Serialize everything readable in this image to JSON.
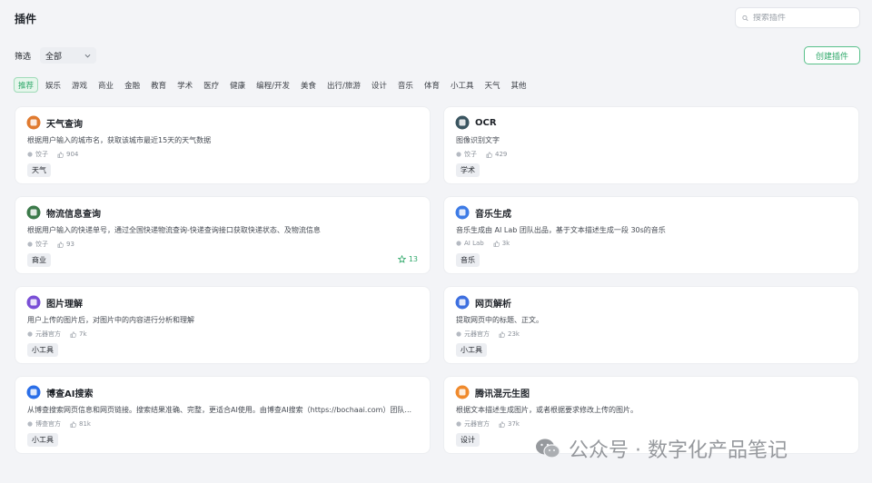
{
  "header": {
    "title": "插件",
    "search_placeholder": "搜索插件"
  },
  "filter": {
    "label": "筛选",
    "selected": "全部"
  },
  "create_button": "创建插件",
  "tags": [
    "推荐",
    "娱乐",
    "游戏",
    "商业",
    "金融",
    "教育",
    "学术",
    "医疗",
    "健康",
    "编程/开发",
    "美食",
    "出行/旅游",
    "设计",
    "音乐",
    "体育",
    "小工具",
    "天气",
    "其他"
  ],
  "cards": [
    {
      "title": "天气查询",
      "desc": "根据用户输入的城市名，获取该城市最近15天的天气数据",
      "author": "饺子",
      "likes": "904",
      "tag": "天气",
      "star": "",
      "icon": "weather-icon",
      "color": "#e07a2f"
    },
    {
      "title": "OCR",
      "desc": "图像识别文字",
      "author": "饺子",
      "likes": "429",
      "tag": "学术",
      "star": "",
      "icon": "ocr-icon",
      "color": "#3a5560"
    },
    {
      "title": "物流信息查询",
      "desc": "根据用户输入的快递单号，通过全国快递物流查询-快递查询接口获取快递状态、及物流信息",
      "author": "饺子",
      "likes": "93",
      "tag": "商业",
      "star": "13",
      "icon": "logistics-icon",
      "color": "#3c7a4a"
    },
    {
      "title": "音乐生成",
      "desc": "音乐生成由 AI Lab 团队出品，基于文本描述生成一段 30s的音乐",
      "author": "AI Lab",
      "likes": "3k",
      "tag": "音乐",
      "star": "",
      "icon": "music-icon",
      "color": "#3d7be6"
    },
    {
      "title": "图片理解",
      "desc": "用户上传的图片后，对图片中的内容进行分析和理解",
      "author": "元器官方",
      "likes": "7k",
      "tag": "小工具",
      "star": "",
      "icon": "image-understand-icon",
      "color": "#7a4fd6"
    },
    {
      "title": "网页解析",
      "desc": "提取网页中的标题、正文。",
      "author": "元器官方",
      "likes": "23k",
      "tag": "小工具",
      "star": "",
      "icon": "web-parse-icon",
      "color": "#3d6fe0"
    },
    {
      "title": "博查AI搜索",
      "desc": "从博查搜索网页信息和网页链接。搜索结果准确、完整，更适合AI使用。由博查AI搜索（https://bochaai.com）团队...",
      "author": "博查官方",
      "likes": "81k",
      "tag": "小工具",
      "star": "",
      "icon": "bocha-icon",
      "color": "#2a6ee8"
    },
    {
      "title": "腾讯混元生图",
      "desc": "根据文本描述生成图片，或者根据要求修改上传的图片。",
      "author": "元器官方",
      "likes": "37k",
      "tag": "设计",
      "star": "",
      "icon": "hunyuan-image-icon",
      "color": "#f08a2c"
    }
  ],
  "watermark": "公众号 · 数字化产品笔记"
}
